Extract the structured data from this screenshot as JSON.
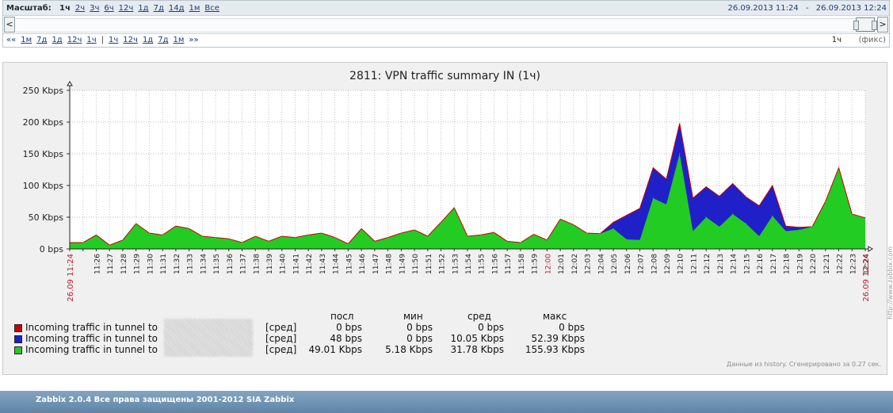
{
  "colors": {
    "red": "#cc0000",
    "blue": "#2020c8",
    "green": "#22cc22",
    "date_red": "#b8222a"
  },
  "period": {
    "zoom_label": "Масштаб:",
    "zoom_options": [
      "1ч",
      "2ч",
      "3ч",
      "6ч",
      "12ч",
      "1д",
      "7д",
      "14д",
      "1м",
      "Все"
    ],
    "active_zoom": "1ч",
    "from": "26.09.2013 11:24",
    "dash": "-",
    "to": "26.09.2013 12:24",
    "back_arrow": "««",
    "back_links": [
      "1м",
      "7д",
      "1д",
      "12ч",
      "1ч"
    ],
    "separator": "|",
    "forward_links": [
      "1ч",
      "12ч",
      "1д",
      "7д",
      "1м"
    ],
    "forward_arrow": "»»",
    "period_value": "1ч",
    "fixed_label": "(фикс)",
    "scroll_left": "<",
    "scroll_right": ">"
  },
  "chart_data": {
    "type": "area",
    "title": "2811: VPN traffic summary IN (1ч)",
    "xlabel": "",
    "ylabel": "",
    "y_unit": "Kbps",
    "ylim": [
      0,
      250
    ],
    "y_ticks": [
      "0 bps",
      "50 Kbps",
      "100 Kbps",
      "150 Kbps",
      "200 Kbps",
      "250 Kbps"
    ],
    "grid": true,
    "stacked": true,
    "x_start_label": "26.09 11:24",
    "x_end_label": "26.09 12:24",
    "x_labels": [
      "11:26",
      "11:27",
      "11:28",
      "11:29",
      "11:30",
      "11:31",
      "11:32",
      "11:33",
      "11:34",
      "11:35",
      "11:36",
      "11:37",
      "11:38",
      "11:39",
      "11:40",
      "11:41",
      "11:42",
      "11:43",
      "11:44",
      "11:45",
      "11:46",
      "11:47",
      "11:48",
      "11:49",
      "11:50",
      "11:51",
      "11:52",
      "11:53",
      "11:54",
      "11:55",
      "11:56",
      "11:57",
      "11:58",
      "11:59",
      "12:00",
      "12:01",
      "12:02",
      "12:03",
      "12:04",
      "12:05",
      "12:06",
      "12:07",
      "12:08",
      "12:09",
      "12:10",
      "12:11",
      "12:12",
      "12:13",
      "12:14",
      "12:15",
      "12:16",
      "12:17",
      "12:18",
      "12:19",
      "12:20",
      "12:21",
      "12:22",
      "12:23",
      "12:24"
    ],
    "x_minutes": [
      0,
      1,
      2,
      3,
      4,
      5,
      6,
      7,
      8,
      9,
      10,
      11,
      12,
      13,
      14,
      15,
      16,
      17,
      18,
      19,
      20,
      21,
      22,
      23,
      24,
      25,
      26,
      27,
      28,
      29,
      30,
      31,
      32,
      33,
      34,
      35,
      36,
      37,
      38,
      39,
      40,
      41,
      42,
      43,
      44,
      45,
      46,
      47,
      48,
      49,
      50,
      51,
      52,
      53,
      54,
      55,
      56,
      57,
      58,
      59,
      60
    ],
    "series": [
      {
        "name": "Incoming traffic in tunnel to",
        "color": "#cc0000",
        "values": [
          0,
          0,
          0,
          0,
          0,
          0,
          0,
          0,
          0,
          0,
          0,
          0,
          0,
          0,
          0,
          0,
          0,
          0,
          0,
          0,
          0,
          0,
          0,
          0,
          0,
          0,
          0,
          0,
          0,
          0,
          0,
          0,
          0,
          0,
          0,
          0,
          0,
          0,
          0,
          0,
          0,
          0,
          0,
          0,
          0,
          0,
          0,
          0,
          0,
          0,
          0,
          0,
          0,
          0,
          0,
          0,
          0,
          0,
          0,
          0,
          0
        ]
      },
      {
        "name": "Incoming traffic in tunnel to",
        "color": "#2020c8",
        "values": [
          0,
          0,
          0,
          0,
          0,
          0,
          0,
          0,
          0,
          0,
          0,
          0,
          0,
          0,
          0,
          0,
          0,
          0,
          0,
          0,
          0,
          0,
          0,
          0,
          0,
          0,
          0,
          0,
          0,
          0,
          0,
          0,
          0,
          0,
          0,
          0,
          0,
          0,
          0,
          0,
          0,
          10,
          38,
          50,
          48,
          40,
          48,
          52,
          48,
          48,
          48,
          42,
          48,
          48,
          8,
          4,
          0,
          0,
          0,
          0,
          0
        ]
      },
      {
        "name": "Incoming traffic in tunnel to",
        "color": "#22cc22",
        "values": [
          10,
          10,
          22,
          6,
          14,
          40,
          25,
          22,
          36,
          32,
          20,
          18,
          16,
          10,
          20,
          12,
          20,
          18,
          22,
          25,
          18,
          8,
          32,
          12,
          18,
          25,
          30,
          20,
          42,
          65,
          20,
          22,
          26,
          12,
          10,
          23,
          14,
          47,
          38,
          25,
          24,
          32,
          15,
          14,
          80,
          70,
          150,
          28,
          50,
          35,
          55,
          40,
          20,
          52,
          28,
          30,
          35,
          75,
          128,
          55,
          49
        ]
      }
    ],
    "legend": {
      "headers": [
        "посл",
        "мин",
        "сред",
        "макс"
      ],
      "rows": [
        {
          "agg": "[сред]",
          "last": "0 bps",
          "min": "0 bps",
          "avg": "0 bps",
          "max": "0 bps"
        },
        {
          "agg": "[сред]",
          "last": "48 bps",
          "min": "0 bps",
          "avg": "10.05 Kbps",
          "max": "52.39 Kbps"
        },
        {
          "agg": "[сред]",
          "last": "49.01 Kbps",
          "min": "5.18 Kbps",
          "avg": "31.78 Kbps",
          "max": "155.93 Kbps"
        }
      ]
    }
  },
  "graph": {
    "generated_note": "Данные из history. Сгенерировано за 0.27 сек.",
    "side_url": "http://www.zabbix.com"
  },
  "footer": {
    "text": "Zabbix 2.0.4 Все права защищены 2001-2012 SIA Zabbix"
  }
}
